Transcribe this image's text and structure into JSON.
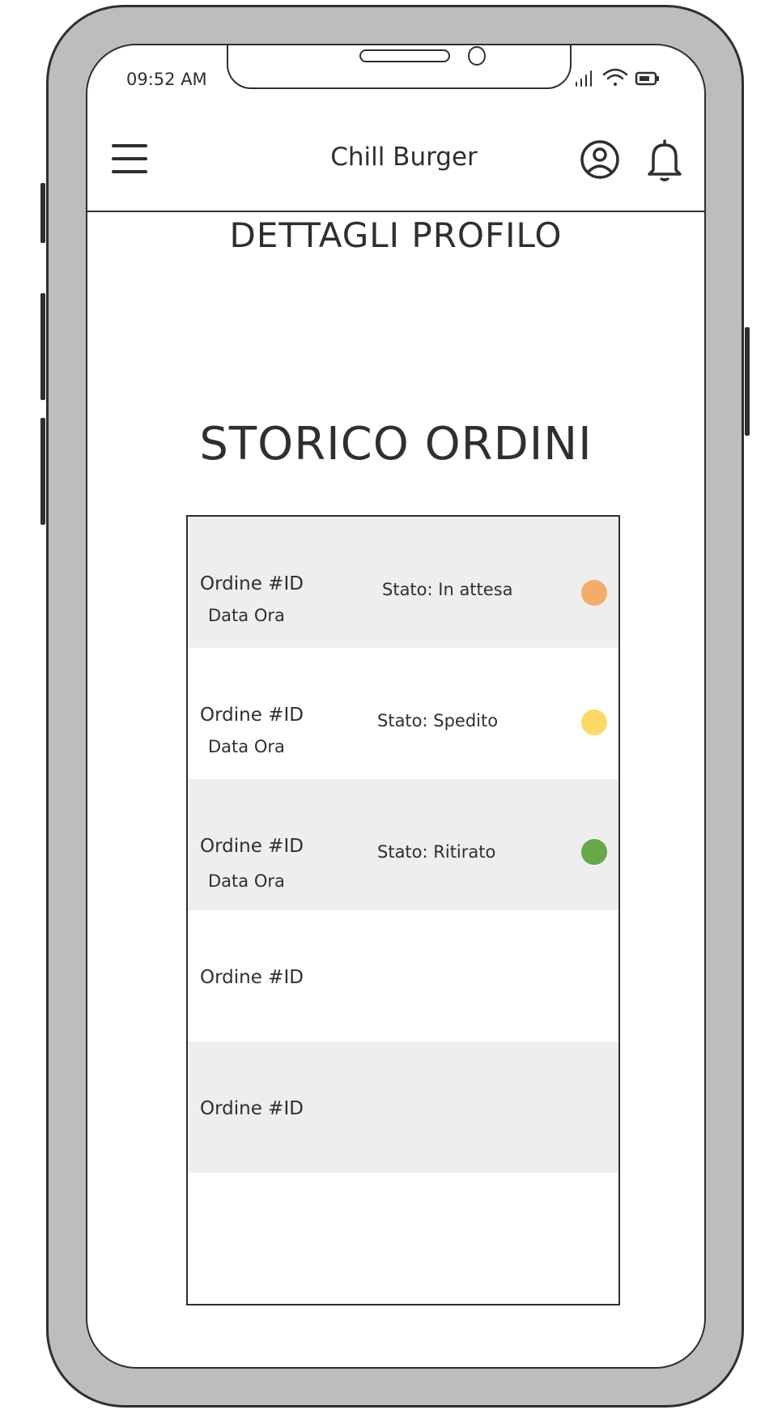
{
  "status_bar": {
    "time": "09:52 AM"
  },
  "header": {
    "title": "Chill Burger"
  },
  "profile_section": {
    "title": "DETTAGLI PROFILO"
  },
  "orders_section": {
    "title": "STORICO ORDINI"
  },
  "orders": [
    {
      "id": "Ordine #ID",
      "date": "Data Ora",
      "status": "Stato: In attesa",
      "status_color": "#f4ac6b"
    },
    {
      "id": "Ordine #ID",
      "date": "Data Ora",
      "status": "Stato: Spedito",
      "status_color": "#fcd966"
    },
    {
      "id": "Ordine #ID",
      "date": "Data Ora",
      "status": "Stato: Ritirato",
      "status_color": "#67a84a"
    },
    {
      "id": "Ordine #ID"
    },
    {
      "id": "Ordine #ID"
    }
  ],
  "icons": [
    "menu-icon",
    "user-profile-icon",
    "bell-icon",
    "signal-icon",
    "wifi-icon",
    "battery-icon"
  ]
}
